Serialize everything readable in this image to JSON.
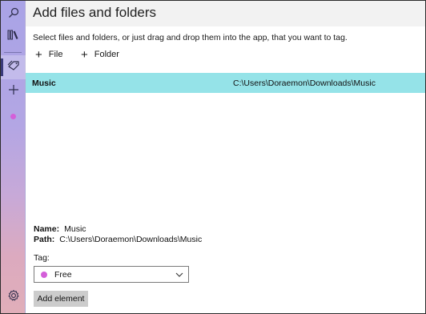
{
  "sidebar": {
    "items": [
      {
        "name": "search",
        "icon": "search-icon"
      },
      {
        "name": "library",
        "icon": "library-icon"
      },
      {
        "name": "tags",
        "icon": "tag-icon",
        "active": true
      },
      {
        "name": "add",
        "icon": "plus-icon"
      },
      {
        "name": "free-tag",
        "icon": "dot-icon",
        "color": "#d45fd9"
      },
      {
        "name": "settings",
        "icon": "gear-icon"
      }
    ]
  },
  "header": {
    "title": "Add files and folders"
  },
  "main": {
    "instructions": "Select files and folders, or just drag and drop them into the app, that you want to tag.",
    "add_file_label": "File",
    "add_folder_label": "Folder",
    "items": [
      {
        "name": "Music",
        "path": "C:\\Users\\Doraemon\\Downloads\\Music",
        "selected": true
      }
    ]
  },
  "details": {
    "name_label": "Name:",
    "name_value": "Music",
    "path_label": "Path:",
    "path_value": "C:\\Users\\Doraemon\\Downloads\\Music",
    "tag_label": "Tag:",
    "tag_selected": "Free",
    "tag_color": "#d45fd9",
    "add_button_label": "Add element"
  },
  "colors": {
    "accent_row": "#95e3e8",
    "sidebar_top": "#a9a3e6",
    "sidebar_bottom": "#e0aeb9"
  }
}
